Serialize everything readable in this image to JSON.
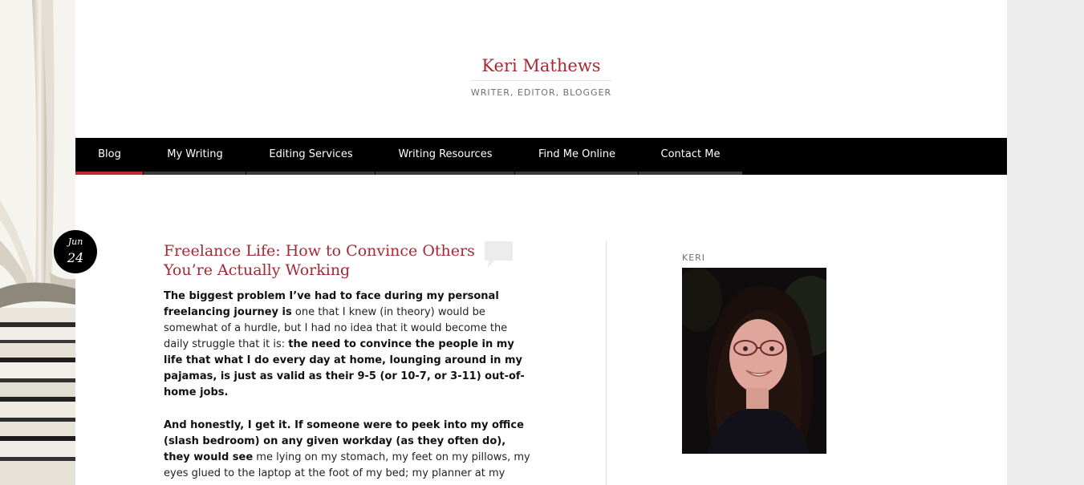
{
  "site": {
    "title": "Keri Mathews",
    "tagline": "WRITER, EDITOR, BLOGGER"
  },
  "nav": {
    "items": [
      {
        "label": "Blog",
        "active": true
      },
      {
        "label": "My Writing",
        "active": false
      },
      {
        "label": "Editing Services",
        "active": false
      },
      {
        "label": "Writing Resources",
        "active": false
      },
      {
        "label": "Find Me Online",
        "active": false
      },
      {
        "label": "Contact Me",
        "active": false
      }
    ]
  },
  "post": {
    "date_month": "Jun",
    "date_day": "24",
    "title": "Freelance Life: How to Convince Others You’re Actually Working",
    "comment_icon": "speech-bubble-icon",
    "paragraphs": [
      [
        {
          "text": "The biggest problem I’ve had to face during my personal freelancing journey is",
          "bold": true
        },
        {
          "text": " one that I knew (in theory) would be somewhat of a hurdle, but I had no idea that it would become the daily struggle that it is: ",
          "bold": false
        },
        {
          "text": "the need to convince the people in my life that what I do every day at home, lounging around in my pajamas, is just as valid as their 9-5 (or 10-7, or 3-11) out-of-home jobs.",
          "bold": true
        }
      ],
      [
        {
          "text": "And honestly, I get it. If someone were to peek into my office (slash bedroom) on any given workday (as they often do), they would see",
          "bold": true
        },
        {
          "text": " me lying on my stomach, my feet on my pillows, my eyes glued to the laptop at the foot of my bed; my planner at my",
          "bold": false
        }
      ]
    ]
  },
  "sidebar": {
    "widget_title": "KERI"
  },
  "colors": {
    "accent": "#a32a33",
    "nav_bg": "#000000",
    "nav_active": "#c0262e",
    "gutter": "#ececec"
  }
}
